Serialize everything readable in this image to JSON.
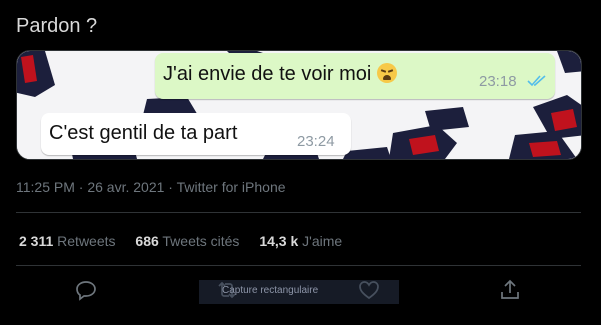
{
  "tweet": {
    "text": "Pardon ?"
  },
  "media": {
    "outgoing": {
      "text": "J'ai envie de te voir moi",
      "emoji": "weary-face-emoji",
      "time": "23:18"
    },
    "incoming": {
      "text": "C'est gentil de ta part",
      "time": "23:24"
    }
  },
  "meta": {
    "text": "11:25 PM · 26 avr. 2021 · Twitter for iPhone"
  },
  "stats": {
    "retweets": {
      "count": "2 311",
      "label": "Retweets"
    },
    "quotes": {
      "count": "686",
      "label": "Tweets cités"
    },
    "likes": {
      "count": "14,3 k",
      "label": "J'aime"
    }
  },
  "actions": [
    "reply-icon",
    "retweet-icon",
    "like-icon",
    "share-icon"
  ],
  "overlay": {
    "text": "Capture rectangulaire"
  },
  "colors": {
    "background": "#000000",
    "text": "#d9d9d9",
    "muted": "#6e767d",
    "outgoing_bubble": "#dcf8c6",
    "read_ticks": "#53bdeb",
    "fist_navy": "#1c1f3c",
    "fist_red": "#c0121d"
  }
}
